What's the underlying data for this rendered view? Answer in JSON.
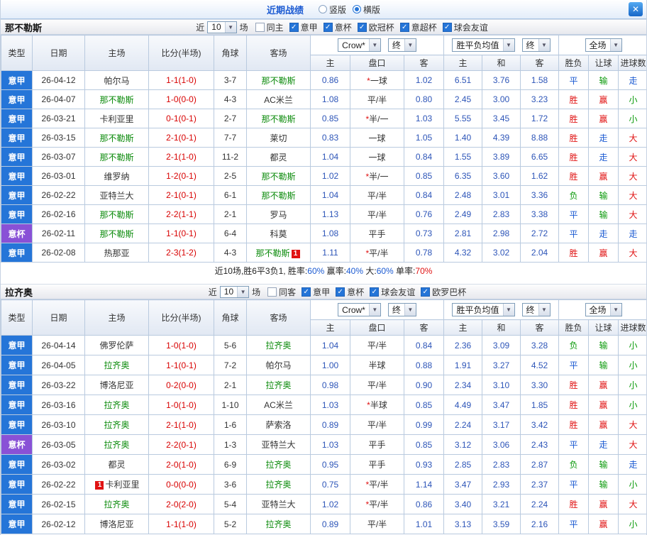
{
  "icons": {
    "chevron_down": "▼",
    "check": "✓",
    "close": "✕"
  },
  "colors": {
    "league_blue": "#2575d8",
    "league_purple": "#8951d6",
    "result_red": "#e01212",
    "result_green": "#0a9a0a",
    "result_blue": "#1b5ad2",
    "score_red": "#d80000",
    "odds_blue": "#2d55b8",
    "team_green": "#0a8a0a",
    "title_blue": "#1b5ad2"
  },
  "topbar": {
    "title": "近期战绩",
    "options": [
      {
        "label": "竖版",
        "selected": false
      },
      {
        "label": "横版",
        "selected": true
      }
    ],
    "close": "✕"
  },
  "sections": [
    {
      "team": "那不勒斯",
      "near": "近",
      "count": "10",
      "unit": "场",
      "filters": [
        {
          "label": "同主",
          "checked": false
        },
        {
          "label": "意甲",
          "checked": true
        },
        {
          "label": "意杯",
          "checked": true
        },
        {
          "label": "欧冠杯",
          "checked": true
        },
        {
          "label": "意超杯",
          "checked": true
        },
        {
          "label": "球会友谊",
          "checked": true
        }
      ],
      "columns": {
        "type": "类型",
        "date": "日期",
        "home": "主场",
        "score": "比分(半场)",
        "corner": "角球",
        "away": "客场"
      },
      "selects": {
        "company": "Crow*",
        "company_final": "终",
        "avg": "胜平负均值",
        "avg_final": "终",
        "scope": "全场"
      },
      "subheaders": [
        "主",
        "盘口",
        "客",
        "主",
        "和",
        "客",
        "胜负",
        "让球",
        "进球数"
      ],
      "rows": [
        {
          "league": "意甲",
          "date": "26-04-12",
          "home": "帕尔马",
          "score": "1-1(1-0)",
          "corner": "3-7",
          "away": "那不勒斯",
          "away_focus": true,
          "odds": [
            "0.86",
            "*一球",
            "1.02"
          ],
          "avgs": [
            "6.51",
            "3.76",
            "1.58"
          ],
          "results": [
            "平",
            "输",
            "走"
          ]
        },
        {
          "league": "意甲",
          "date": "26-04-07",
          "home": "那不勒斯",
          "home_focus": true,
          "score": "1-0(0-0)",
          "corner": "4-3",
          "away": "AC米兰",
          "odds": [
            "1.08",
            "平/半",
            "0.80"
          ],
          "avgs": [
            "2.45",
            "3.00",
            "3.23"
          ],
          "results": [
            "胜",
            "赢",
            "小"
          ]
        },
        {
          "league": "意甲",
          "date": "26-03-21",
          "home": "卡利亚里",
          "score": "0-1(0-1)",
          "corner": "2-7",
          "away": "那不勒斯",
          "away_focus": true,
          "odds": [
            "0.85",
            "*半/一",
            "1.03"
          ],
          "avgs": [
            "5.55",
            "3.45",
            "1.72"
          ],
          "results": [
            "胜",
            "赢",
            "小"
          ]
        },
        {
          "league": "意甲",
          "date": "26-03-15",
          "home": "那不勒斯",
          "home_focus": true,
          "score": "2-1(0-1)",
          "corner": "7-7",
          "away": "莱切",
          "odds": [
            "0.83",
            "一球",
            "1.05"
          ],
          "avgs": [
            "1.40",
            "4.39",
            "8.88"
          ],
          "results": [
            "胜",
            "走",
            "大"
          ]
        },
        {
          "league": "意甲",
          "date": "26-03-07",
          "home": "那不勒斯",
          "home_focus": true,
          "score": "2-1(1-0)",
          "corner": "11-2",
          "away": "都灵",
          "odds": [
            "1.04",
            "一球",
            "0.84"
          ],
          "avgs": [
            "1.55",
            "3.89",
            "6.65"
          ],
          "results": [
            "胜",
            "走",
            "大"
          ]
        },
        {
          "league": "意甲",
          "date": "26-03-01",
          "home": "维罗纳",
          "score": "1-2(0-1)",
          "corner": "2-5",
          "away": "那不勒斯",
          "away_focus": true,
          "odds": [
            "1.02",
            "*半/一",
            "0.85"
          ],
          "avgs": [
            "6.35",
            "3.60",
            "1.62"
          ],
          "results": [
            "胜",
            "赢",
            "大"
          ]
        },
        {
          "league": "意甲",
          "date": "26-02-22",
          "home": "亚特兰大",
          "score": "2-1(0-1)",
          "corner": "6-1",
          "away": "那不勒斯",
          "away_focus": true,
          "odds": [
            "1.04",
            "平/半",
            "0.84"
          ],
          "avgs": [
            "2.48",
            "3.01",
            "3.36"
          ],
          "results": [
            "负",
            "输",
            "大"
          ]
        },
        {
          "league": "意甲",
          "date": "26-02-16",
          "home": "那不勒斯",
          "home_focus": true,
          "score": "2-2(1-1)",
          "corner": "2-1",
          "away": "罗马",
          "odds": [
            "1.13",
            "平/半",
            "0.76"
          ],
          "avgs": [
            "2.49",
            "2.83",
            "3.38"
          ],
          "results": [
            "平",
            "输",
            "大"
          ]
        },
        {
          "league": "意杯",
          "cup": true,
          "date": "26-02-11",
          "home": "那不勒斯",
          "home_focus": true,
          "score": "1-1(0-1)",
          "corner": "6-4",
          "away": "科莫",
          "odds": [
            "1.08",
            "平手",
            "0.73"
          ],
          "avgs": [
            "2.81",
            "2.98",
            "2.72"
          ],
          "results": [
            "平",
            "走",
            "走"
          ]
        },
        {
          "league": "意甲",
          "date": "26-02-08",
          "home": "热那亚",
          "score": "2-3(1-2)",
          "corner": "4-3",
          "away": "那不勒斯",
          "away_focus": true,
          "away_badge": "1",
          "away_badge_pos": "after",
          "odds": [
            "1.11",
            "*平/半",
            "0.78"
          ],
          "avgs": [
            "4.32",
            "3.02",
            "2.04"
          ],
          "results": [
            "胜",
            "赢",
            "大"
          ]
        }
      ],
      "summary": [
        {
          "text": "近10场,胜6平3负1, 胜率:",
          "color": "plain"
        },
        {
          "text": "60%",
          "color": "blue"
        },
        {
          "text": " 赢率:",
          "color": "plain"
        },
        {
          "text": "40%",
          "color": "blue"
        },
        {
          "text": " 大:",
          "color": "plain"
        },
        {
          "text": "60%",
          "color": "blue"
        },
        {
          "text": " 单率:",
          "color": "plain"
        },
        {
          "text": "70%",
          "color": "red"
        }
      ]
    },
    {
      "team": "拉齐奥",
      "near": "近",
      "count": "10",
      "unit": "场",
      "filters": [
        {
          "label": "同客",
          "checked": false
        },
        {
          "label": "意甲",
          "checked": true
        },
        {
          "label": "意杯",
          "checked": true
        },
        {
          "label": "球会友谊",
          "checked": true
        },
        {
          "label": "欧罗巴杯",
          "checked": true
        }
      ],
      "columns": {
        "type": "类型",
        "date": "日期",
        "home": "主场",
        "score": "比分(半场)",
        "corner": "角球",
        "away": "客场"
      },
      "selects": {
        "company": "Crow*",
        "company_final": "终",
        "avg": "胜平负均值",
        "avg_final": "终",
        "scope": "全场"
      },
      "subheaders": [
        "主",
        "盘口",
        "客",
        "主",
        "和",
        "客",
        "胜负",
        "让球",
        "进球数"
      ],
      "rows": [
        {
          "league": "意甲",
          "date": "26-04-14",
          "home": "佛罗伦萨",
          "score": "1-0(1-0)",
          "corner": "5-6",
          "away": "拉齐奥",
          "away_focus": true,
          "odds": [
            "1.04",
            "平/半",
            "0.84"
          ],
          "avgs": [
            "2.36",
            "3.09",
            "3.28"
          ],
          "results": [
            "负",
            "输",
            "小"
          ]
        },
        {
          "league": "意甲",
          "date": "26-04-05",
          "home": "拉齐奥",
          "home_focus": true,
          "score": "1-1(0-1)",
          "corner": "7-2",
          "away": "帕尔马",
          "odds": [
            "1.00",
            "半球",
            "0.88"
          ],
          "avgs": [
            "1.91",
            "3.27",
            "4.52"
          ],
          "results": [
            "平",
            "输",
            "小"
          ]
        },
        {
          "league": "意甲",
          "date": "26-03-22",
          "home": "博洛尼亚",
          "score": "0-2(0-0)",
          "corner": "2-1",
          "away": "拉齐奥",
          "away_focus": true,
          "odds": [
            "0.98",
            "平/半",
            "0.90"
          ],
          "avgs": [
            "2.34",
            "3.10",
            "3.30"
          ],
          "results": [
            "胜",
            "赢",
            "小"
          ]
        },
        {
          "league": "意甲",
          "date": "26-03-16",
          "home": "拉齐奥",
          "home_focus": true,
          "score": "1-0(1-0)",
          "corner": "1-10",
          "away": "AC米兰",
          "odds": [
            "1.03",
            "*半球",
            "0.85"
          ],
          "avgs": [
            "4.49",
            "3.47",
            "1.85"
          ],
          "results": [
            "胜",
            "赢",
            "小"
          ]
        },
        {
          "league": "意甲",
          "date": "26-03-10",
          "home": "拉齐奥",
          "home_focus": true,
          "score": "2-1(1-0)",
          "corner": "1-6",
          "away": "萨索洛",
          "odds": [
            "0.89",
            "平/半",
            "0.99"
          ],
          "avgs": [
            "2.24",
            "3.17",
            "3.42"
          ],
          "results": [
            "胜",
            "赢",
            "大"
          ]
        },
        {
          "league": "意杯",
          "cup": true,
          "date": "26-03-05",
          "home": "拉齐奥",
          "home_focus": true,
          "score": "2-2(0-1)",
          "corner": "1-3",
          "away": "亚特兰大",
          "odds": [
            "1.03",
            "平手",
            "0.85"
          ],
          "avgs": [
            "3.12",
            "3.06",
            "2.43"
          ],
          "results": [
            "平",
            "走",
            "大"
          ]
        },
        {
          "league": "意甲",
          "date": "26-03-02",
          "home": "都灵",
          "score": "2-0(1-0)",
          "corner": "6-9",
          "away": "拉齐奥",
          "away_focus": true,
          "odds": [
            "0.95",
            "平手",
            "0.93"
          ],
          "avgs": [
            "2.85",
            "2.83",
            "2.87"
          ],
          "results": [
            "负",
            "输",
            "走"
          ]
        },
        {
          "league": "意甲",
          "date": "26-02-22",
          "home": "卡利亚里",
          "home_badge": "1",
          "home_badge_pos": "before",
          "score": "0-0(0-0)",
          "corner": "3-6",
          "away": "拉齐奥",
          "away_focus": true,
          "odds": [
            "0.75",
            "*平/半",
            "1.14"
          ],
          "avgs": [
            "3.47",
            "2.93",
            "2.37"
          ],
          "results": [
            "平",
            "输",
            "小"
          ]
        },
        {
          "league": "意甲",
          "date": "26-02-15",
          "home": "拉齐奥",
          "home_focus": true,
          "score": "2-0(2-0)",
          "corner": "5-4",
          "away": "亚特兰大",
          "odds": [
            "1.02",
            "*平/半",
            "0.86"
          ],
          "avgs": [
            "3.40",
            "3.21",
            "2.24"
          ],
          "results": [
            "胜",
            "赢",
            "大"
          ]
        },
        {
          "league": "意甲",
          "date": "26-02-12",
          "home": "博洛尼亚",
          "score": "1-1(1-0)",
          "corner": "5-2",
          "away": "拉齐奥",
          "away_focus": true,
          "odds": [
            "0.89",
            "平/半",
            "1.01"
          ],
          "avgs": [
            "3.13",
            "3.59",
            "2.16"
          ],
          "results": [
            "平",
            "赢",
            "小"
          ]
        }
      ],
      "summary": []
    }
  ]
}
